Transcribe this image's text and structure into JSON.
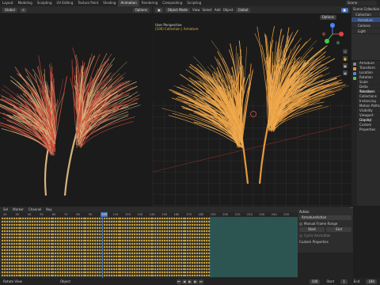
{
  "menu": {
    "items": [
      "Layout",
      "Modeling",
      "Sculpting",
      "UV Editing",
      "Texture Paint",
      "Shading",
      "Animation",
      "Rendering",
      "Compositing",
      "Scripting"
    ],
    "active_index": 6,
    "scene_label": "Scene"
  },
  "left_viewport": {
    "mode": "Global",
    "options_label": "Options"
  },
  "right_viewport": {
    "mode": "Object Mode",
    "menu": [
      "View",
      "Select",
      "Add",
      "Object"
    ],
    "transform": "Global",
    "options_label": "Options",
    "overlay_title": "User Perspective",
    "overlay_sub": "(100) Collection | Armature"
  },
  "colors": {
    "left_tree_base": "#d6b27a",
    "left_tree_tip": "#c9493a",
    "right_tree": "#e79a3a",
    "accent": "#4772b3",
    "keyframe": "#e2b640",
    "action_strip": "#2c5a56"
  },
  "timeline": {
    "header_items": [
      "Sel",
      "Marker",
      "Channel",
      "Key"
    ],
    "ruler_ticks": [
      "20",
      "30",
      "40",
      "50",
      "60",
      "70",
      "80",
      "90",
      "100",
      "110",
      "120",
      "130",
      "140",
      "150",
      "160",
      "170",
      "180",
      "190",
      "200",
      "210",
      "220",
      "230",
      "240",
      "250"
    ],
    "current_frame": "100",
    "interpolation": "Nearest Frame"
  },
  "action_panel": {
    "title": "Action",
    "action_name": "ArmatureAction",
    "checkbox_label": "Manual Frame Range",
    "start_label": "Start",
    "end_label": "End",
    "cyclic_label": "Cyclic Animation",
    "custom_props": "Custom Properties"
  },
  "outliner": {
    "items": [
      "Scene Collection",
      "Collection",
      "Armature",
      "Camera",
      "Light"
    ]
  },
  "properties": {
    "items": [
      "Armature",
      "Transform",
      "Location",
      "Rotation",
      "Scale",
      "Delta Transform",
      "Relations",
      "Collections",
      "Instancing",
      "Motion Paths",
      "Visibility",
      "Viewport Display",
      "Line Art",
      "Custom Properties"
    ]
  },
  "status_bar": {
    "left": "Rotate View",
    "right": "Object",
    "frame": "100",
    "start_label": "Start",
    "start": "1",
    "end_label": "End",
    "end": "180"
  }
}
